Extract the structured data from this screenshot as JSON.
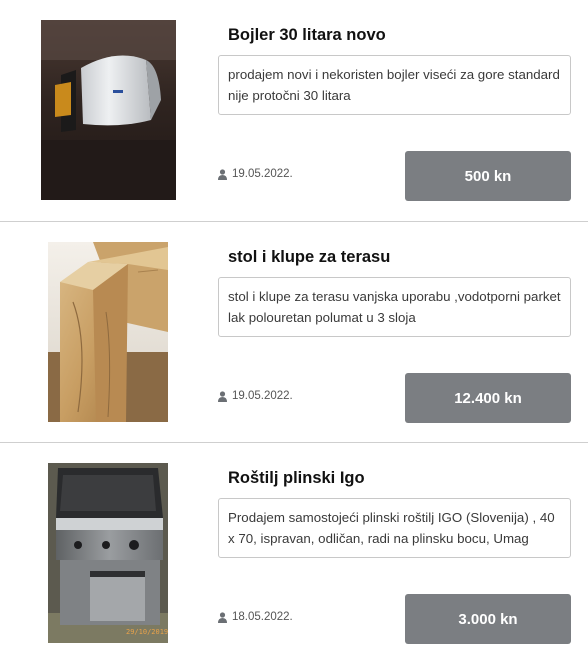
{
  "listings": [
    {
      "image_icon": "boiler-photo",
      "title": "Bojler 30 litara novo",
      "description": "prodajem novi i nekoristen bojler viseći za gore standard nije protočni 30 litara",
      "date": "19.05.2022.",
      "price": "500 kn"
    },
    {
      "image_icon": "table-photo",
      "title": "stol i klupe za terasu",
      "description": "stol i klupe za terasu vanjska uporabu ,vodotporni parket lak polouretan polumat u 3 sloja",
      "date": "19.05.2022.",
      "price": "12.400 kn"
    },
    {
      "image_icon": "grill-photo",
      "title": "Roštilj plinski Igo",
      "description": "Prodajem samostojeći plinski roštilj IGO (Slovenija) , 40 x 70, ispravan, odličan, radi na plinsku bocu, Umag",
      "date": "18.05.2022.",
      "price": "3.000 kn"
    }
  ],
  "grill_photo_stamp": "29/10/2019"
}
